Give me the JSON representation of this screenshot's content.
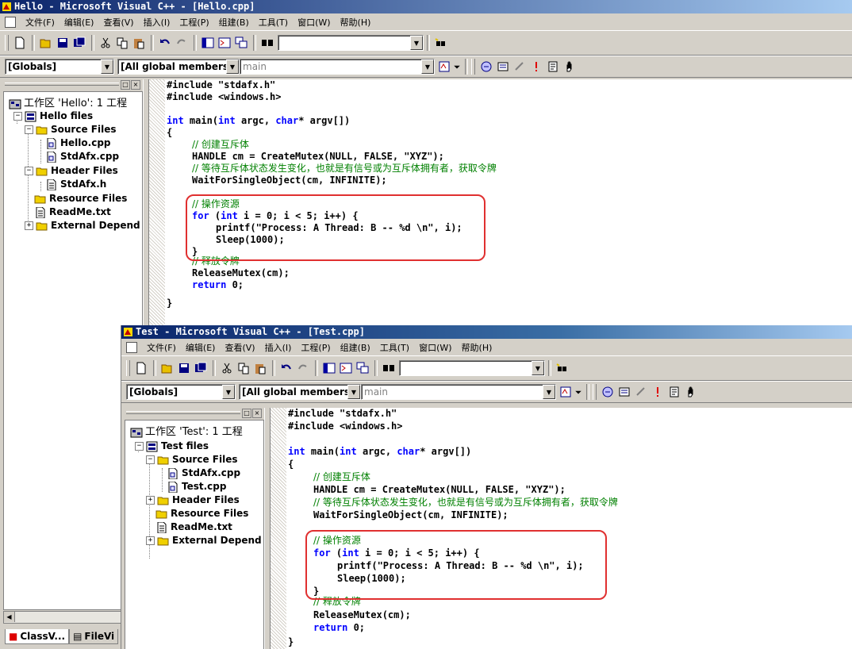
{
  "windows": [
    {
      "title": "Hello - Microsoft Visual C++ - [Hello.cpp]",
      "menu": [
        "文件(F)",
        "编辑(E)",
        "查看(V)",
        "插入(I)",
        "工程(P)",
        "组建(B)",
        "工具(T)",
        "窗口(W)",
        "帮助(H)"
      ],
      "class_combo": "[Globals]",
      "members_combo": "[All global members",
      "function_combo": "main",
      "workspace_title": "工作区 'Hello': 1 工程",
      "tree": {
        "project": "Hello files",
        "source_folder": "Source Files",
        "source_files": [
          "Hello.cpp",
          "StdAfx.cpp"
        ],
        "header_folder": "Header Files",
        "header_files": [
          "StdAfx.h"
        ],
        "resource_folder": "Resource Files",
        "readme": "ReadMe.txt",
        "external": "External Depend"
      },
      "code": {
        "inc1": "#include \"stdafx.h\"",
        "inc2": "#include <windows.h>",
        "main_int": "int",
        "main_mid": " main(",
        "main_int2": "int",
        "main_argc": " argc, ",
        "main_char": "char",
        "main_tail": "* argv[])",
        "open": "{",
        "c_create": "// 创建互斥体",
        "create": "HANDLE cm = CreateMutex(NULL, FALSE, \"XYZ\");",
        "c_wait": "// 等待互斥体状态发生变化，也就是有信号或为互斥体拥有者，获取令牌",
        "wait": "WaitForSingleObject(cm, INFINITE);",
        "c_op": "// 操作资源",
        "for_kw": "for",
        "for_open": " (",
        "for_int": "int",
        "for_rest": " i = 0; i < 5; i++) {",
        "printf": "printf(\"Process: A Thread: B -- %d \\n\", i);",
        "sleep": "Sleep(1000);",
        "close_for": "}",
        "c_release": "// 释放令牌",
        "release": "ReleaseMutex(cm);",
        "ret_kw": "return",
        "ret_rest": " 0;",
        "close": "}"
      },
      "bottom_tabs": [
        "ClassV...",
        "FileVi"
      ]
    },
    {
      "title": "Test - Microsoft Visual C++ - [Test.cpp]",
      "menu": [
        "文件(F)",
        "编辑(E)",
        "查看(V)",
        "插入(I)",
        "工程(P)",
        "组建(B)",
        "工具(T)",
        "窗口(W)",
        "帮助(H)"
      ],
      "class_combo": "[Globals]",
      "members_combo": "[All global members",
      "function_combo": "main",
      "workspace_title": "工作区 'Test': 1 工程",
      "tree": {
        "project": "Test files",
        "source_folder": "Source Files",
        "source_files": [
          "StdAfx.cpp",
          "Test.cpp"
        ],
        "header_folder": "Header Files",
        "resource_folder": "Resource Files",
        "readme": "ReadMe.txt",
        "external": "External Depend"
      }
    }
  ],
  "colors": {
    "keyword": "#0000ff",
    "comment": "#008000",
    "highlight": "#e03030",
    "titlebar": "#0a246a"
  }
}
